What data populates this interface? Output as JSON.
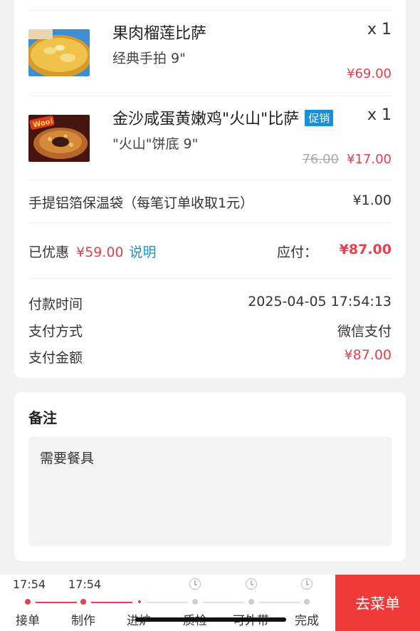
{
  "items": [
    {
      "name": "果肉榴莲比萨",
      "spec": "经典手拍 9\"",
      "qty": "x 1",
      "price": "¥69.00",
      "old_price": "",
      "badge": "",
      "image": "durian-pizza-image"
    },
    {
      "name": "金沙咸蛋黄嫩鸡\"火山\"比萨",
      "spec": "\"火山\"饼底 9\"",
      "qty": "x 1",
      "price": "¥17.00",
      "old_price": "76.00",
      "badge": "促销",
      "image": "volcano-pizza-image",
      "image_text": "Woo!"
    }
  ],
  "bag": {
    "label": "手提铝箔保温袋（每笔订单收取1元）",
    "price": "¥1.00"
  },
  "discount": {
    "label": "已优惠",
    "amount": "¥59.00",
    "explain": "说明",
    "pay_label": "应付：",
    "pay_amount": "¥87.00"
  },
  "payment": {
    "time_label": "付款时间",
    "time_value": "2025-04-05 17:54:13",
    "method_label": "支付方式",
    "method_value": "微信支付",
    "amount_label": "支付金额",
    "amount_value": "¥87.00"
  },
  "remark": {
    "title": "备注",
    "text": "需要餐具"
  },
  "progress": {
    "steps": [
      {
        "label": "接单",
        "time": "17:54",
        "state": "done"
      },
      {
        "label": "制作",
        "time": "17:54",
        "state": "done"
      },
      {
        "label": "进炉",
        "time": "",
        "state": "current"
      },
      {
        "label": "质检",
        "time": "",
        "state": "pending"
      },
      {
        "label": "可外带",
        "time": "",
        "state": "pending"
      },
      {
        "label": "完成",
        "time": "",
        "state": "pending"
      }
    ],
    "action_label": "去菜单"
  },
  "colors": {
    "accent_red": "#e8404a",
    "button_red": "#f03a3a",
    "link_blue": "#1b8fd6"
  }
}
